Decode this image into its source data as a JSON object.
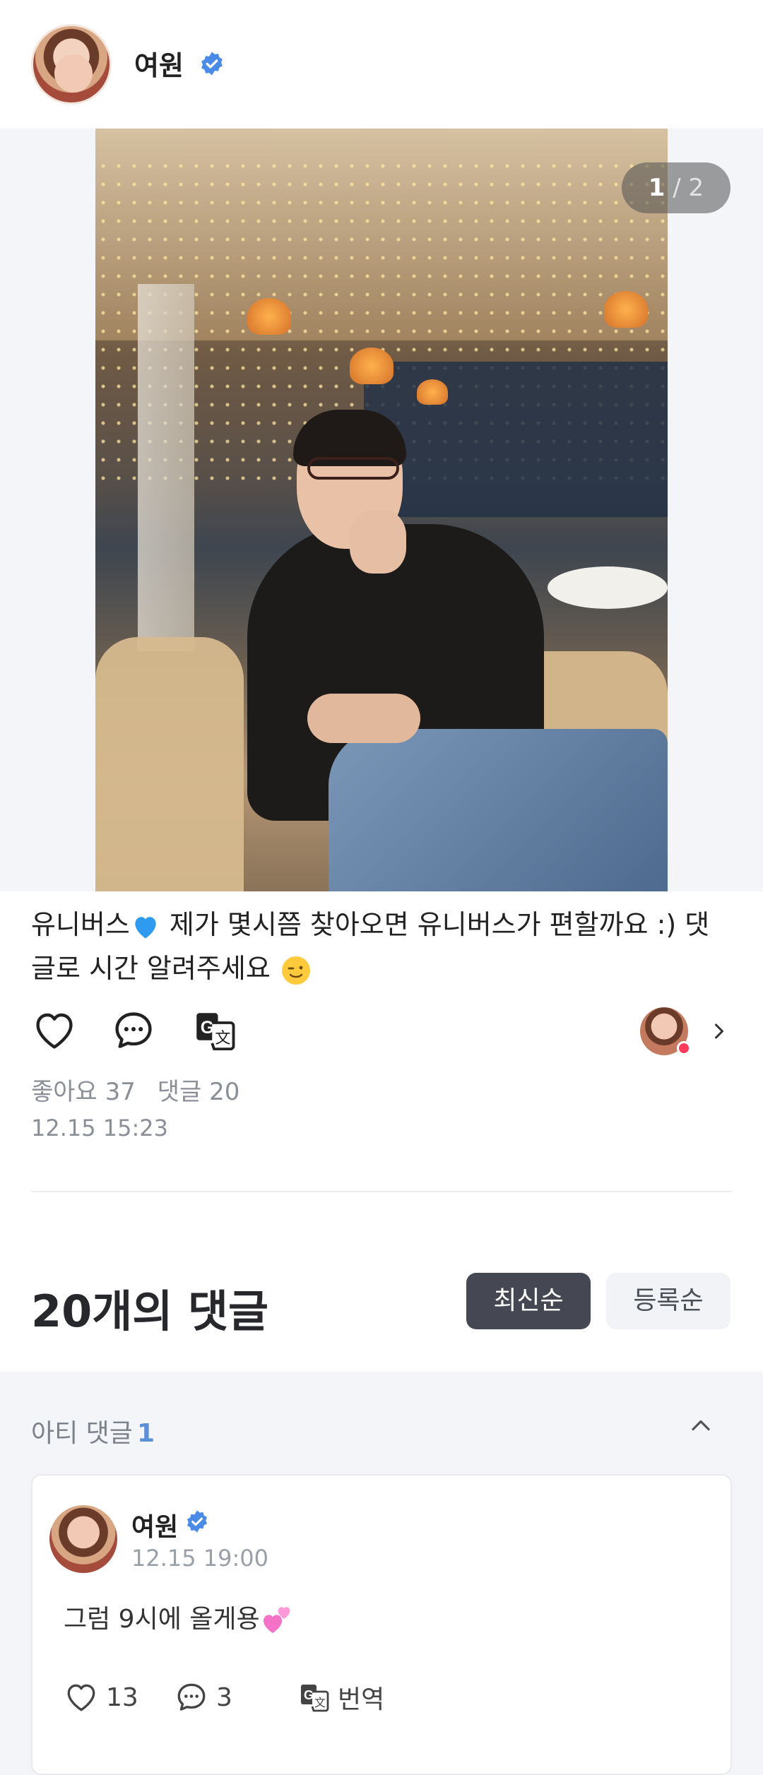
{
  "header": {
    "name": "여원",
    "verified_icon": "verified-badge-icon"
  },
  "photo": {
    "counter_current": "1",
    "counter_sep": " / ",
    "counter_total": "2"
  },
  "post": {
    "caption_part1": "유니버스",
    "caption_part2": " 제가 몇시쯤 찾아오면 유니버스가 편할까요 :) 댓글로 시간 알려주세요",
    "likes": "좋아요 37",
    "comments": "댓글 20",
    "date": "12.15 15:23"
  },
  "comments_header": {
    "title": "20개의 댓글",
    "sort_latest": "최신순",
    "sort_registered": "등록순"
  },
  "artist_comments": {
    "label": "아티 댓글",
    "count": "1",
    "comment": {
      "name": "여원",
      "time": "12.15 19:00",
      "text": "그럼 9시에 올게용",
      "likes": "13",
      "replies": "3",
      "translate": "번역"
    }
  },
  "colors": {
    "accent_blue": "#5b8fd9",
    "dark_button": "#454852",
    "heart_red": "#ff3b5c"
  }
}
